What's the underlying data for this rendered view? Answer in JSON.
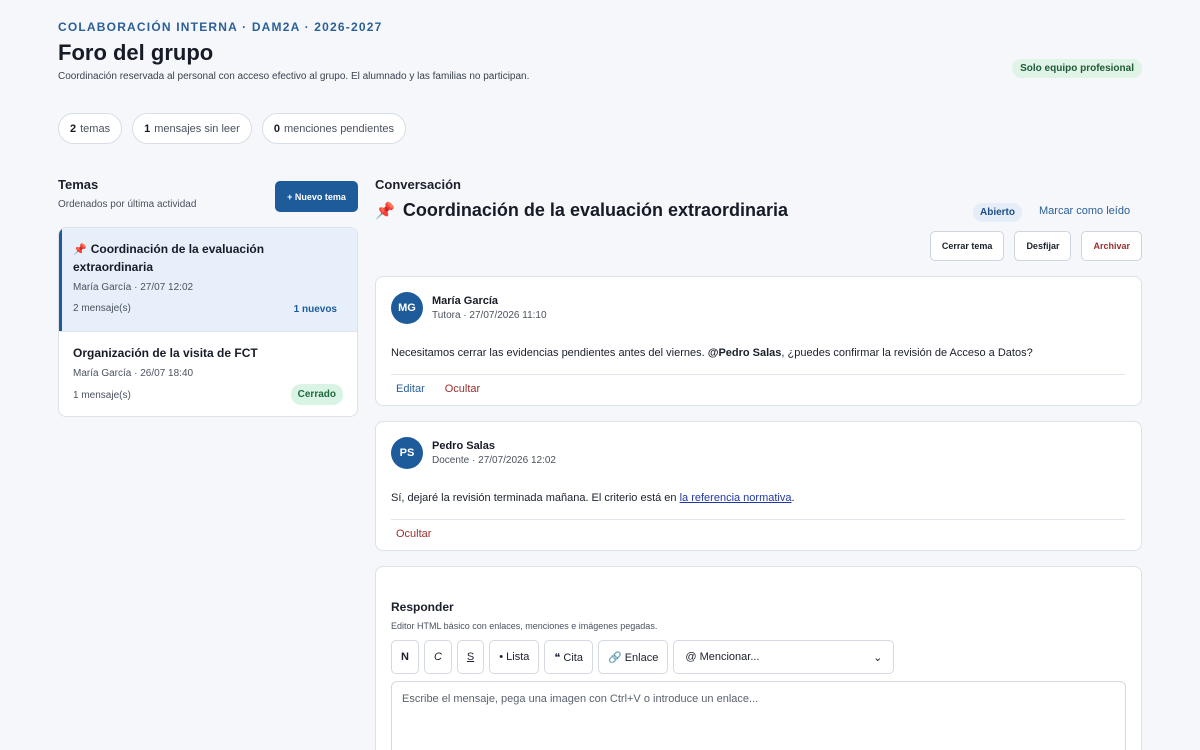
{
  "header": {
    "eyebrow": "COLABORACIÓN INTERNA · DAM2A · 2026-2027",
    "title": "Foro del grupo",
    "subtitle": "Coordinación reservada al personal con acceso efectivo al grupo. El alumnado y las familias no participan.",
    "team_badge": "Solo equipo profesional"
  },
  "stats": [
    {
      "count": "2",
      "label": "temas"
    },
    {
      "count": "1",
      "label": "mensajes sin leer"
    },
    {
      "count": "0",
      "label": "menciones pendientes"
    }
  ],
  "topics": {
    "title": "Temas",
    "subtitle": "Ordenados por última actividad",
    "new_button": "+ Nuevo tema",
    "items": [
      {
        "title": "Coordinación de la evaluación extraordinaria",
        "meta": "María García · 27/07 12:02",
        "count": "2 mensaje(s)",
        "badge": "1 nuevos",
        "pinned": true
      },
      {
        "title": "Organización de la visita de FCT",
        "meta": "María García · 26/07 18:40",
        "count": "1 mensaje(s)",
        "badge": "Cerrado",
        "pinned": false
      }
    ]
  },
  "conversation": {
    "label": "Conversación",
    "title": "Coordinación de la evaluación extraordinaria",
    "status": "Abierto",
    "mark_read": "Marcar como leído",
    "actions": {
      "close": "Cerrar tema",
      "unpin": "Desfijar",
      "archive": "Archivar"
    },
    "messages": [
      {
        "initials": "MG",
        "author": "María García",
        "role": "Tutora · 27/07/2026 11:10",
        "body_before": "Necesitamos cerrar las evidencias pendientes antes del viernes. ",
        "mention": "@Pedro Salas",
        "body_after": ", ¿puedes confirmar la revisión de Acceso a Datos?",
        "edit": "Editar",
        "hide": "Ocultar"
      },
      {
        "initials": "PS",
        "author": "Pedro Salas",
        "role": "Docente · 27/07/2026 12:02",
        "body_before": "Sí, dejaré la revisión terminada mañana. El criterio está en ",
        "link": "la referencia normativa",
        "body_after": ".",
        "hide": "Ocultar"
      }
    ]
  },
  "reply": {
    "title": "Responder",
    "subtitle": "Editor HTML básico con enlaces, menciones e imágenes pegadas.",
    "toolbar": {
      "bold": "N",
      "italic": "C",
      "strike": "S",
      "list": "• Lista",
      "quote": "❝ Cita",
      "link": "🔗 Enlace"
    },
    "mention_select": "@ Mencionar...",
    "placeholder": "Escribe el mensaje, pega una imagen con Ctrl+V o introduce un enlace..."
  }
}
